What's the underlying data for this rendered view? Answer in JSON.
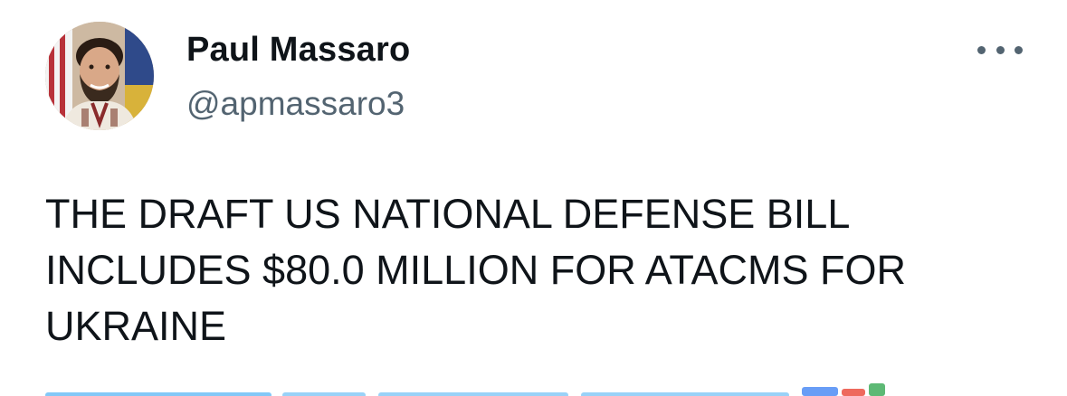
{
  "author": {
    "display_name": "Paul Massaro",
    "handle": "@apmassaro3"
  },
  "tweet": {
    "text": "THE DRAFT US NATIONAL DEFENSE BILL\nINCLUDES $80.0 MILLION FOR ATACMS FOR\nUKRAINE"
  },
  "icons": {
    "more": "more-horizontal-icon"
  },
  "colors": {
    "text_primary": "#0f1419",
    "text_secondary": "#536471",
    "link": "#1d9bf0"
  }
}
